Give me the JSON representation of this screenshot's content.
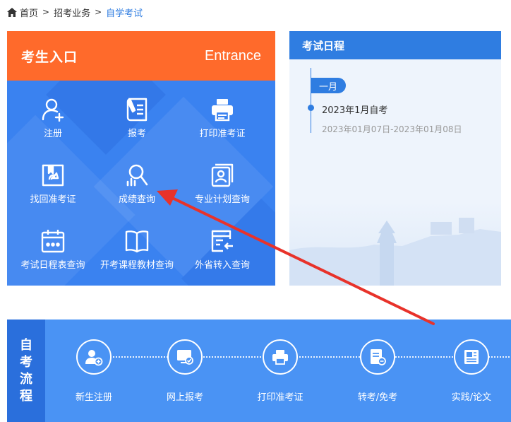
{
  "breadcrumb": {
    "home": "首页",
    "separator": ">",
    "level2": "招考业务",
    "current": "自学考试"
  },
  "entrance": {
    "title": "考生入口",
    "title_en": "Entrance",
    "items": [
      {
        "label": "注册",
        "icon": "user-add-icon"
      },
      {
        "label": "报考",
        "icon": "register-form-icon"
      },
      {
        "label": "打印准考证",
        "icon": "printer-icon"
      },
      {
        "label": "找回准考证",
        "icon": "recover-ticket-icon"
      },
      {
        "label": "成绩查询",
        "icon": "score-search-icon"
      },
      {
        "label": "专业计划查询",
        "icon": "plan-document-icon"
      },
      {
        "label": "考试日程表查询",
        "icon": "calendar-icon"
      },
      {
        "label": "开考课程教材查询",
        "icon": "book-icon"
      },
      {
        "label": "外省转入查询",
        "icon": "transfer-in-icon"
      }
    ]
  },
  "schedule": {
    "title": "考试日程",
    "month": "一月",
    "event_title": "2023年1月自考",
    "event_date": "2023年01月07日-2023年01月08日"
  },
  "process": {
    "label": [
      "自",
      "考",
      "流",
      "程"
    ],
    "steps": [
      {
        "label": "新生注册",
        "icon": "new-user-icon"
      },
      {
        "label": "网上报考",
        "icon": "online-apply-icon"
      },
      {
        "label": "打印准考证",
        "icon": "printer-icon"
      },
      {
        "label": "转考/免考",
        "icon": "transfer-exempt-icon"
      },
      {
        "label": "实践/论文",
        "icon": "thesis-icon"
      }
    ]
  },
  "colors": {
    "orange": "#ff6a2b",
    "blue": "#3a82f0",
    "dark_blue": "#2f7de1",
    "arrow_red": "#e8322a"
  }
}
